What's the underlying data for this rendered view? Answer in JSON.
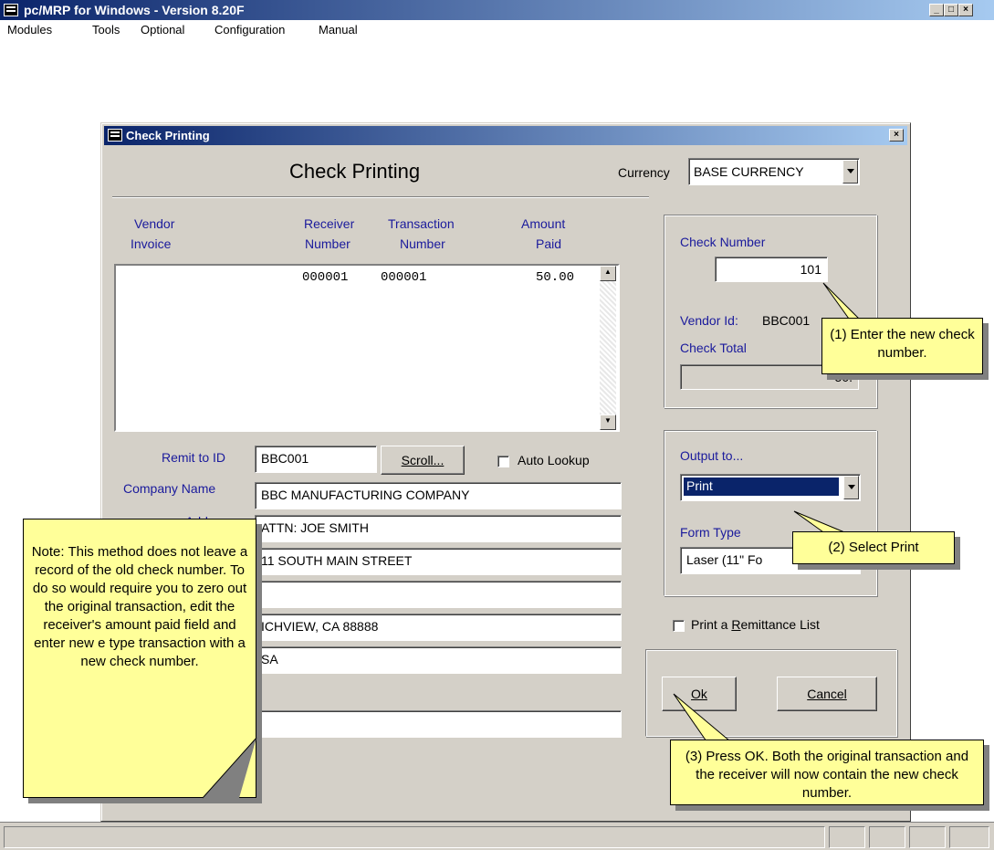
{
  "app": {
    "title": "pc/MRP for Windows - Version 8.20F",
    "menu": [
      "Modules",
      "Tools",
      "Optional",
      "Configuration",
      "Manual"
    ]
  },
  "dialog": {
    "title": "Check Printing",
    "heading": "Check Printing",
    "currency_label": "Currency",
    "currency_value": "BASE CURRENCY",
    "columns": {
      "vendor_invoice_1": "Vendor",
      "vendor_invoice_2": "Invoice",
      "receiver_1": "Receiver",
      "receiver_2": "Number",
      "transaction_1": "Transaction",
      "transaction_2": "Number",
      "amount_1": "Amount",
      "amount_2": "Paid"
    },
    "rows": [
      {
        "receiver": "000001",
        "transaction": "000001",
        "amount": "50.00"
      }
    ],
    "check_number_label": "Check Number",
    "check_number_value": "101",
    "vendor_id_label": "Vendor Id:",
    "vendor_id_value": "BBC001",
    "check_total_label": "Check Total",
    "check_total_value": "50.",
    "output_label": "Output to...",
    "output_value": "Print",
    "form_type_label": "Form Type",
    "form_type_value": "Laser (11\" Fo",
    "remittance_label": "Print a Remittance List",
    "remit_id_label": "Remit to ID",
    "remit_id_value": "BBC001",
    "scroll_button": "Scroll...",
    "auto_lookup_label": "Auto Lookup",
    "company_name_label": "Company Name",
    "company_name_value": "BBC MANUFACTURING COMPANY",
    "address_label": "Address",
    "address_lines": [
      "ATTN: JOE SMITH",
      "11 SOUTH MAIN STREET",
      "",
      "ICHVIEW, CA 88888",
      "SA"
    ],
    "ok_button": "Ok",
    "cancel_button": "Cancel"
  },
  "callouts": {
    "step1": "(1) Enter the new check number.",
    "step2": "(2) Select Print",
    "step3": "(3)  Press OK.  Both the original transaction and the receiver will now contain the new check number.",
    "note": "Note:  This method does not leave a record of the old check number.  To do so would require you to zero out the original transaction, edit the receiver's amount paid field and enter new e type transaction with a new check number."
  },
  "colors": {
    "title_bar": "#0a246a",
    "label_blue": "#1a1a9c",
    "callout_bg": "#ffff99",
    "dialog_bg": "#d4d0c8",
    "selection": "#0a246a"
  }
}
